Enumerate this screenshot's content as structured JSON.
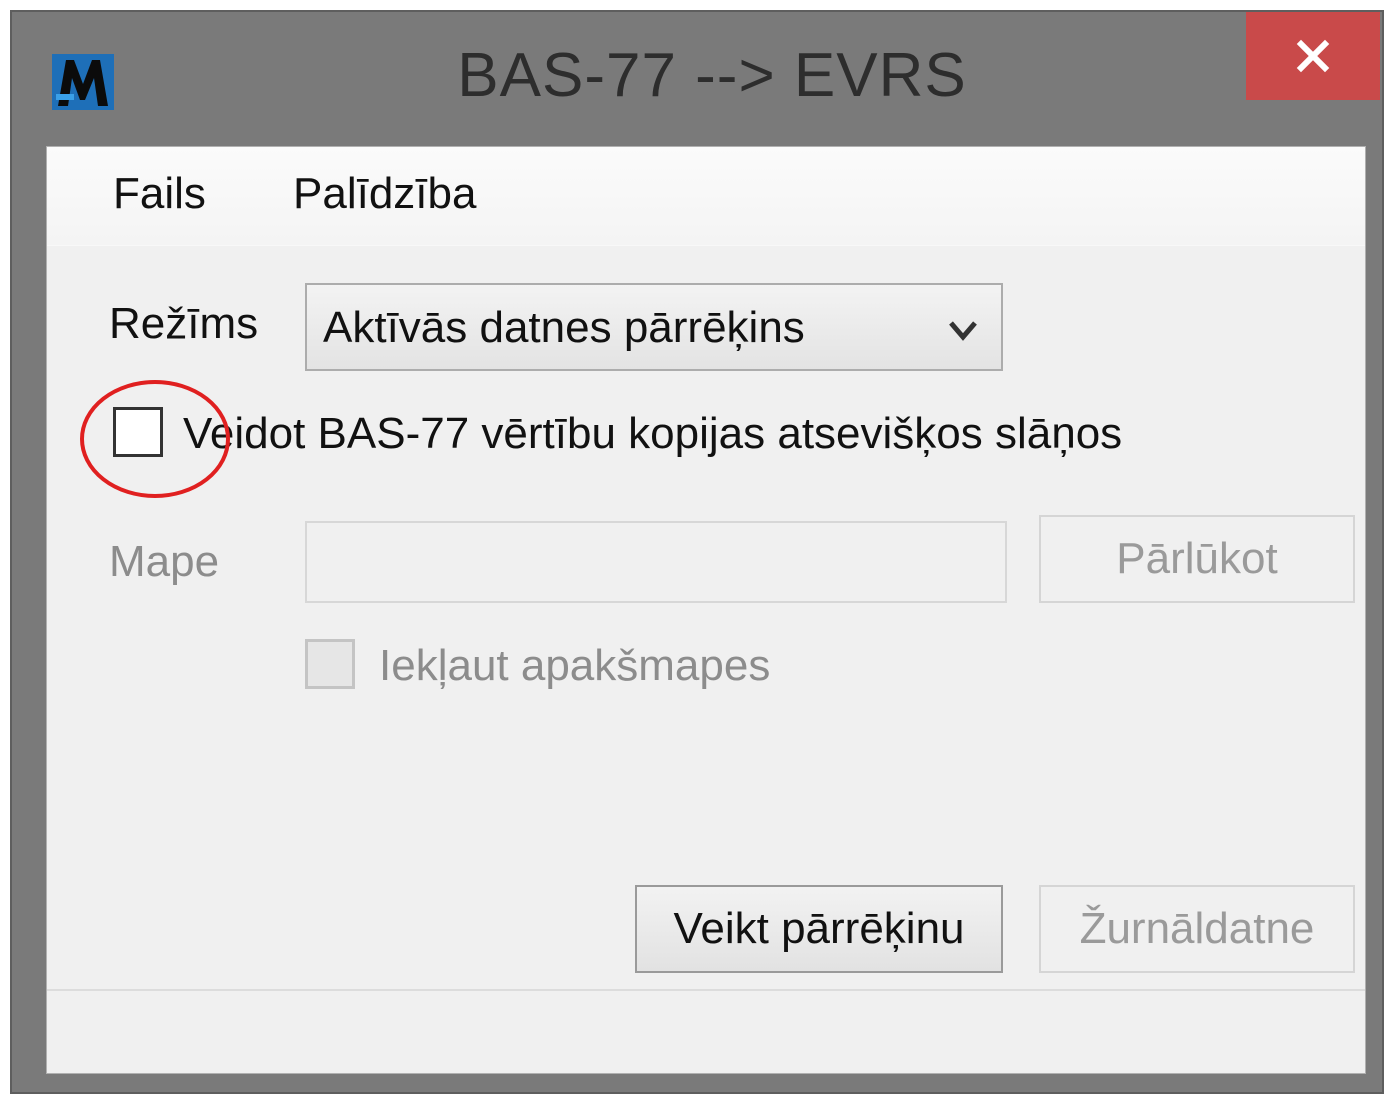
{
  "window": {
    "title": "BAS-77 --> EVRS"
  },
  "icons": {
    "app": "app-mu-icon",
    "close": "close-icon",
    "dropdown": "chevron-down-icon"
  },
  "colors": {
    "close_button": "#c94a4a",
    "highlight_circle": "#e02020"
  },
  "menu": {
    "items": [
      {
        "label": "Fails"
      },
      {
        "label": "Palīdzība"
      }
    ]
  },
  "form": {
    "mode_label": "Režīms",
    "mode_value": "Aktīvās datnes pārrēķins",
    "copy_checkbox_label": "Veidot BAS-77 vērtību kopijas atsevišķos slāņos",
    "copy_checkbox_checked": false,
    "folder_label": "Mape",
    "folder_value": "",
    "browse_button": "Pārlūkot",
    "subfolders_label": "Iekļaut apakšmapes",
    "subfolders_checked": false
  },
  "actions": {
    "run_button": "Veikt pārrēķinu",
    "log_button": "Žurnāldatne"
  }
}
